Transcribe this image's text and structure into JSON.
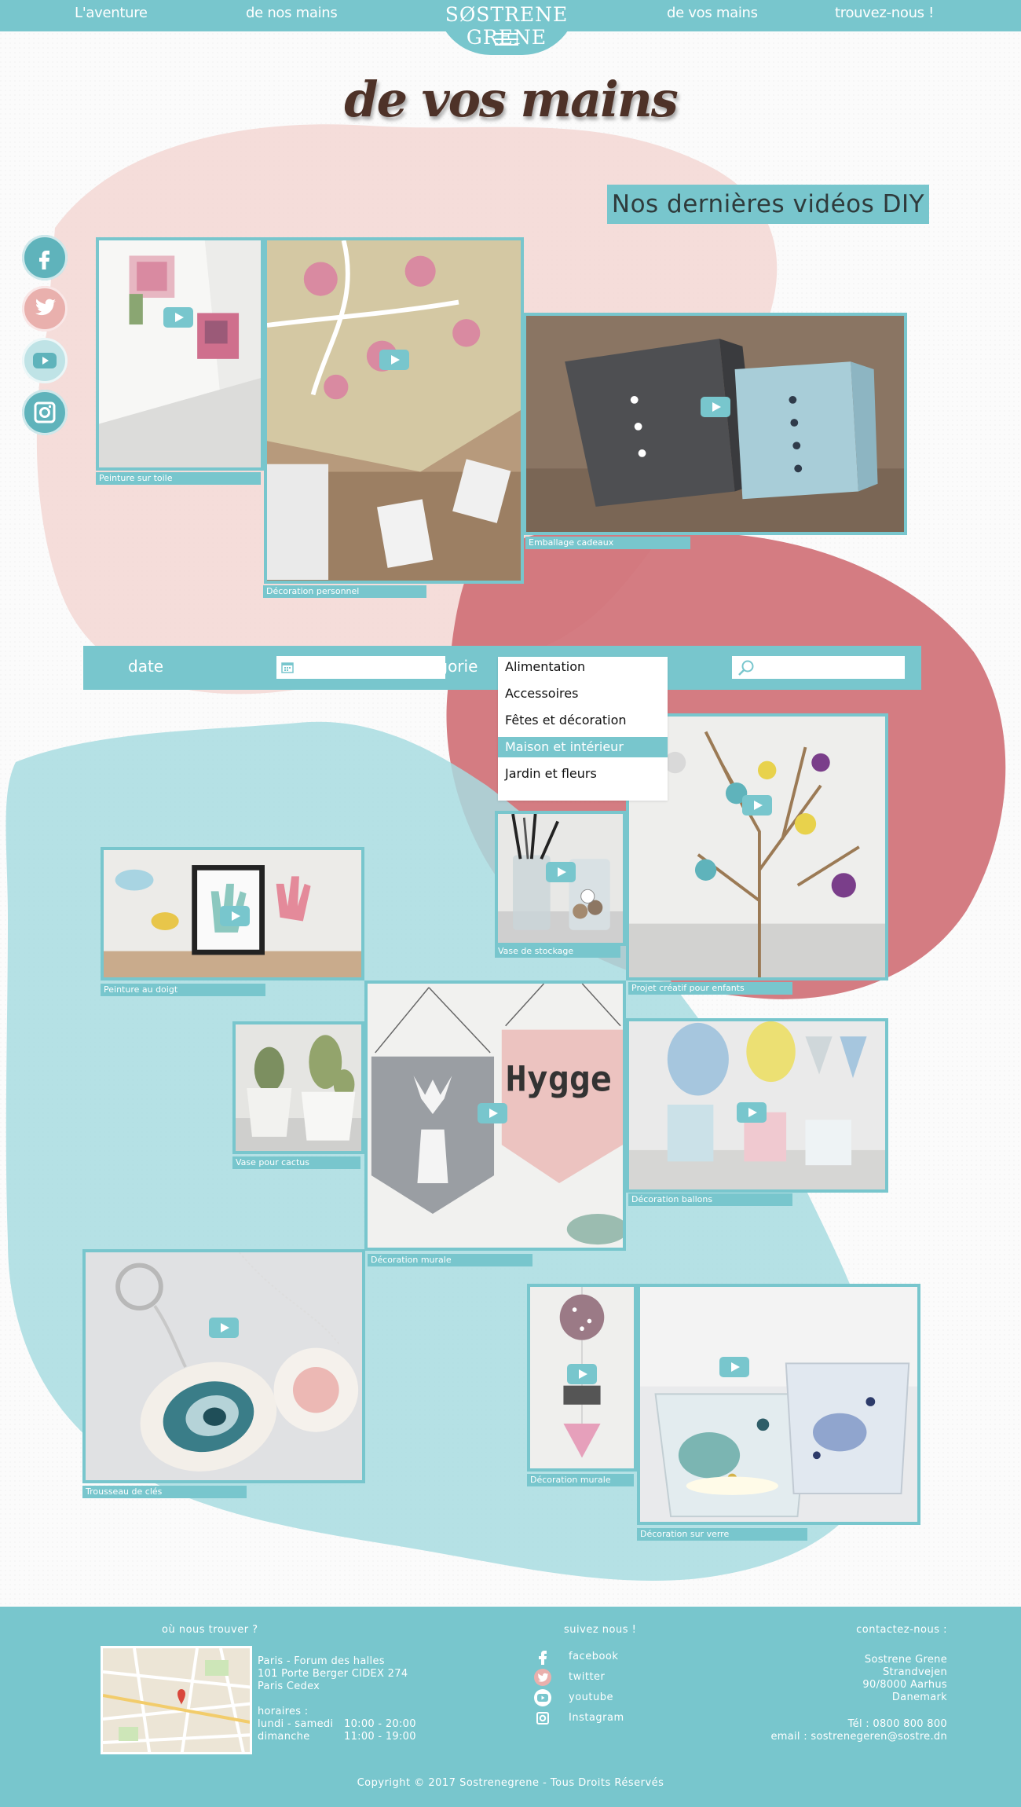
{
  "nav": {
    "links": [
      "L'aventure",
      "de nos mains",
      "de vos mains",
      "trouvez-nous !"
    ],
    "brand": "SØSTRENE GRENE"
  },
  "page_title": "de vos mains",
  "section_title": "Nos dernières vidéos DIY",
  "social_sidebar": [
    "facebook-icon",
    "twitter-icon",
    "youtube-icon",
    "instagram-icon"
  ],
  "videos_top": [
    {
      "caption": "Peinture sur toile"
    },
    {
      "caption": "Décoration personnel"
    },
    {
      "caption": "Emballage cadeaux"
    }
  ],
  "filter": {
    "date_label": "date",
    "category_label": "catégorie",
    "date_value": "",
    "search_value": "",
    "category_options": [
      "Alimentation",
      "Accessoires",
      "Fêtes et décoration",
      "Maison et intérieur",
      "Jardin et fleurs"
    ],
    "category_selected": "Maison et intérieur"
  },
  "videos_grid": [
    {
      "caption": "Vase de stockage"
    },
    {
      "caption": "Projet créatif pour enfants"
    },
    {
      "caption": "Peinture au doigt"
    },
    {
      "caption": "Vase pour cactus"
    },
    {
      "caption": "Décoration murale"
    },
    {
      "caption": "Décoration ballons"
    },
    {
      "caption": "Trousseau de clés"
    },
    {
      "caption": "Décoration murale"
    },
    {
      "caption": "Décoration sur verre"
    }
  ],
  "footer": {
    "where_title": "où nous trouver ?",
    "address": [
      "Paris - Forum des halles",
      "101 Porte Berger CIDEX 274",
      "Paris Cedex"
    ],
    "hours_title": "horaires :",
    "hours": [
      {
        "days": "lundi - samedi",
        "time": "10:00 - 20:00"
      },
      {
        "days": "dimanche",
        "time": "11:00 - 19:00"
      }
    ],
    "follow_title": "suivez nous !",
    "follow_links": [
      "facebook",
      "twitter",
      "youtube",
      "Instagram"
    ],
    "contact_title": "contactez-nous :",
    "contact_lines": [
      "Sostrene Grene",
      "Strandvejen",
      "90/8000 Aarhus",
      "Danemark"
    ],
    "phone": "Tél : 0800 800 800",
    "email": "email : sostrenegeren@sostre.dn",
    "copyright": "Copyright © 2017 Sostrenegrene - Tous Droits Réservés"
  },
  "colors": {
    "accent": "#78c6cd",
    "pink_blob": "#f3d7d3",
    "red_blob": "#cf6e74",
    "blue_blob": "#a8dce0",
    "title_brown": "#4e3228"
  }
}
